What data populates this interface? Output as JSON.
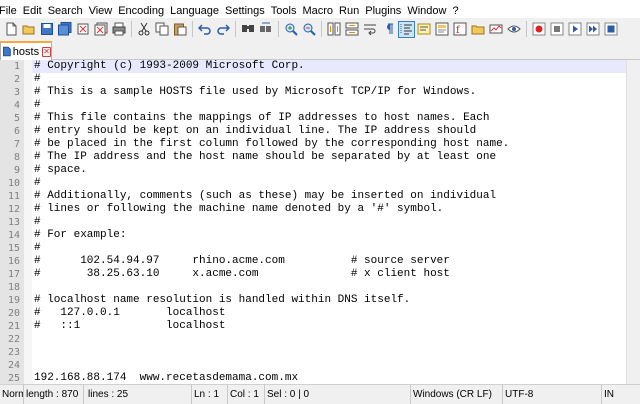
{
  "menu": [
    "File",
    "Edit",
    "Search",
    "View",
    "Encoding",
    "Language",
    "Settings",
    "Tools",
    "Macro",
    "Run",
    "Plugins",
    "Window",
    "?"
  ],
  "tab": {
    "label": "hosts"
  },
  "editor": {
    "lines": [
      {
        "num": "1",
        "text": "# Copyright (c) 1993-2009 Microsoft Corp."
      },
      {
        "num": "2",
        "text": "#"
      },
      {
        "num": "3",
        "text": "# This is a sample HOSTS file used by Microsoft TCP/IP for Windows."
      },
      {
        "num": "4",
        "text": "#"
      },
      {
        "num": "5",
        "text": "# This file contains the mappings of IP addresses to host names. Each"
      },
      {
        "num": "6",
        "text": "# entry should be kept on an individual line. The IP address should"
      },
      {
        "num": "7",
        "text": "# be placed in the first column followed by the corresponding host name."
      },
      {
        "num": "8",
        "text": "# The IP address and the host name should be separated by at least one"
      },
      {
        "num": "9",
        "text": "# space."
      },
      {
        "num": "10",
        "text": "#"
      },
      {
        "num": "11",
        "text": "# Additionally, comments (such as these) may be inserted on individual"
      },
      {
        "num": "12",
        "text": "# lines or following the machine name denoted by a '#' symbol."
      },
      {
        "num": "13",
        "text": "#"
      },
      {
        "num": "14",
        "text": "# For example:"
      },
      {
        "num": "15",
        "text": "#"
      },
      {
        "num": "16",
        "text": "#      102.54.94.97     rhino.acme.com          # source server"
      },
      {
        "num": "17",
        "text": "#       38.25.63.10     x.acme.com              # x client host"
      },
      {
        "num": "18",
        "text": ""
      },
      {
        "num": "19",
        "text": "# localhost name resolution is handled within DNS itself."
      },
      {
        "num": "20",
        "text": "#   127.0.0.1       localhost"
      },
      {
        "num": "21",
        "text": "#   ::1             localhost"
      },
      {
        "num": "22",
        "text": ""
      },
      {
        "num": "23",
        "text": ""
      },
      {
        "num": "24",
        "text": ""
      },
      {
        "num": "25",
        "text": "192.168.88.174  www.recetasdemama.com.mx"
      }
    ]
  },
  "status": {
    "type": "Normal text file",
    "length": "length : 870",
    "lines": "lines : 25",
    "ln": "Ln : 1",
    "col": "Col : 1",
    "sel": "Sel : 0 | 0",
    "eol": "Windows (CR LF)",
    "encoding": "UTF-8",
    "mode": "IN"
  },
  "colors": {
    "tab_accent": "#f9a93a",
    "current_line": "#e8e8ff",
    "gutter": "#e4e4e4"
  }
}
